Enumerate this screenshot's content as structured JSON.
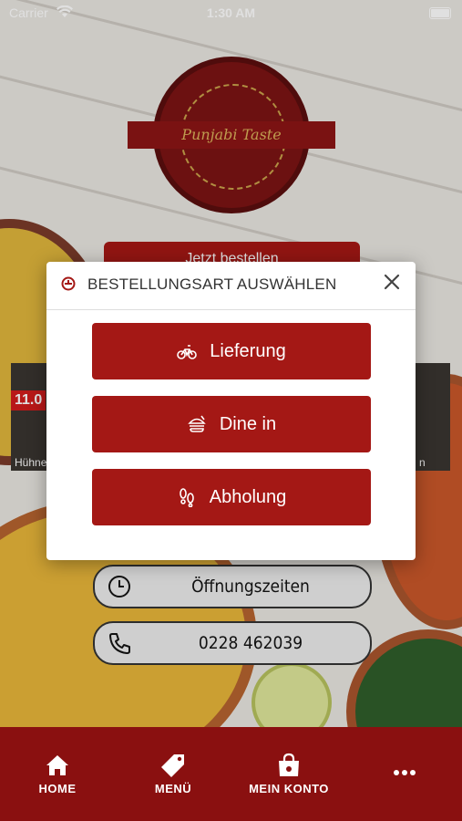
{
  "status_bar": {
    "carrier": "Carrier",
    "time": "1:30 AM"
  },
  "logo": {
    "text": "Punjabi Taste"
  },
  "behind": {
    "order_button": "Jetzt bestellen",
    "left_card_price": "11.0",
    "left_card_caption": "Hühne",
    "right_card_caption": "n"
  },
  "info_buttons": [
    {
      "label": "Öffnungszeiten",
      "icon": "clock-icon"
    },
    {
      "label": "0228 462039",
      "icon": "phone-icon"
    }
  ],
  "modal": {
    "title": "BESTELLUNGSART AUSWÄHLEN",
    "options": [
      {
        "label": "Lieferung",
        "icon": "bicycle-icon"
      },
      {
        "label": "Dine in",
        "icon": "burger-icon"
      },
      {
        "label": "Abholung",
        "icon": "footsteps-icon"
      }
    ]
  },
  "tabbar": {
    "items": [
      {
        "label": "HOME",
        "icon": "home-icon"
      },
      {
        "label": "MENÜ",
        "icon": "tag-icon"
      },
      {
        "label": "MEIN KONTO",
        "icon": "bag-icon"
      },
      {
        "label": "",
        "icon": "more-icon"
      }
    ]
  },
  "colors": {
    "brand_red": "#a41815",
    "tabbar_bg": "#8a1010",
    "pill_bg": "#cfcfcf"
  }
}
